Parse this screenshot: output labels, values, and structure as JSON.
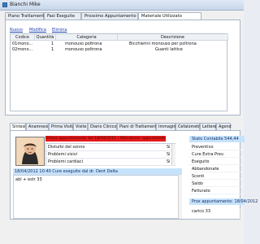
{
  "window": {
    "title": "Bianchi Mike"
  },
  "top_tabs": [
    {
      "label": "Piano Trattamento"
    },
    {
      "label": "Fasi Eseguite"
    },
    {
      "label": "Prossimo Appuntamento"
    },
    {
      "label": "Materiale Utilizzato"
    }
  ],
  "actions": {
    "new": "Nuovo",
    "edit": "Modifica",
    "delete": "Elimina"
  },
  "grid": {
    "columns": [
      "Codice",
      "Quantità",
      "Categoria",
      "Descrizione"
    ],
    "rows": [
      [
        "01mono...",
        "1",
        "monouso poltrona",
        "Bicchierini monouso per poltrona"
      ],
      [
        "02mono...",
        "1",
        "monouso poltrona",
        "Guanti lattice"
      ]
    ]
  },
  "bottom_tabs": [
    {
      "label": "Sintesi"
    },
    {
      "label": "Anamnesi"
    },
    {
      "label": "Prima Visita"
    },
    {
      "label": "Visite"
    },
    {
      "label": "Diario Clinico"
    },
    {
      "label": "Piani di Trattamento"
    },
    {
      "label": "Immagini"
    },
    {
      "label": "Cefalometrie"
    },
    {
      "label": "Lettere"
    },
    {
      "label": "Agend"
    }
  ],
  "alert": {
    "text": "Ultimo appuntamento del 18/04/2012 - Attenzione: appuntamento da fissare per il Dr. Delta"
  },
  "checks": [
    {
      "label": "Disturbi del sonno",
      "value": "Si"
    },
    {
      "label": "Problemi visivi",
      "value": "Si"
    },
    {
      "label": "Problemi cardiaci",
      "value": "Si"
    }
  ],
  "last_visit": {
    "text": "18/04/2012 10:40 Cure eseguite dal dr. Dent Delta"
  },
  "notes": {
    "text": "abl + estr 33"
  },
  "stats": {
    "header": "Stato Contabile 544,44",
    "rows": [
      "Preventivo",
      "Cure Extra Prev.",
      "Eseguito",
      "Abbandonate",
      "Sconti",
      "Saldo",
      "Fatturato"
    ]
  },
  "next": {
    "header": "Prox appuntamento: 18/04/2012",
    "value": "carico 33"
  }
}
